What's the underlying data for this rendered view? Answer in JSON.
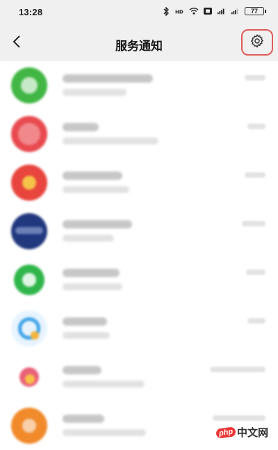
{
  "status_bar": {
    "time": "13:28",
    "battery": "77"
  },
  "header": {
    "title": "服务通知",
    "back_icon": "chevron-left-icon",
    "settings_icon": "gear-icon",
    "highlight_color": "#e05a5a"
  },
  "notifications": [
    {
      "avatar_color": "#41b645"
    },
    {
      "avatar_color": "#e84a4f"
    },
    {
      "avatar_color": "#e8453e"
    },
    {
      "avatar_color": "#22387e"
    },
    {
      "avatar_color": "#35b54a"
    },
    {
      "avatar_color": "#3aa0e6"
    },
    {
      "avatar_color": "#e7506a"
    },
    {
      "avatar_color": "#f08a2b"
    }
  ],
  "watermark": {
    "logo": "php",
    "text": "中文网"
  }
}
